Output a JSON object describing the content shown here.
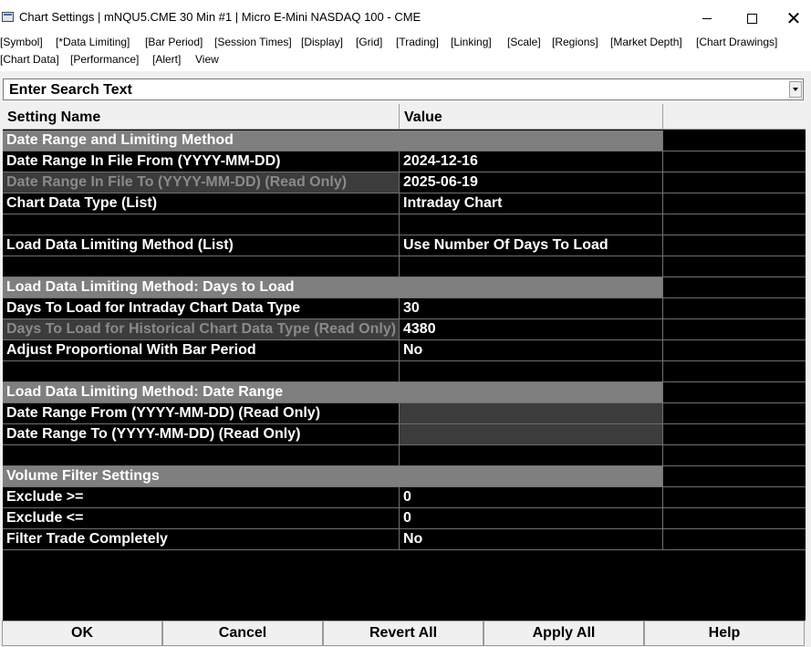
{
  "window": {
    "title": "Chart Settings | mNQU5.CME  30 Min  #1 | Micro E-Mini NASDAQ 100 - CME",
    "minimize_icon": "minimize-icon",
    "maximize_icon": "maximize-icon",
    "close_glyph": "✕"
  },
  "menu": {
    "items": [
      "[Symbol]",
      "[*Data Limiting]",
      "[Bar Period]",
      "[Session Times]",
      "[Display]",
      "[Grid]",
      "[Trading]",
      "[Linking]",
      "[Scale]",
      "[Regions]",
      "[Market Depth]",
      "[Chart Drawings]",
      "[Chart Data]",
      "[Performance]",
      "[Alert]",
      "View"
    ]
  },
  "search": {
    "text": "Enter Search Text"
  },
  "table": {
    "headers": {
      "name": "Setting Name",
      "value": "Value"
    },
    "rows": [
      {
        "type": "section",
        "name": "Date Range and Limiting Method",
        "value": ""
      },
      {
        "type": "normal",
        "name": "Date Range In File From (YYYY-MM-DD)",
        "value": "2024-12-16"
      },
      {
        "type": "readonly",
        "name": "Date Range In File To (YYYY-MM-DD) (Read Only)",
        "value": "2025-06-19"
      },
      {
        "type": "normal",
        "name": "Chart Data Type (List)",
        "value": "Intraday Chart"
      },
      {
        "type": "blank",
        "name": "",
        "value": ""
      },
      {
        "type": "normal",
        "name": "Load Data Limiting Method (List)",
        "value": "Use Number Of Days To Load"
      },
      {
        "type": "blank",
        "name": "",
        "value": ""
      },
      {
        "type": "section",
        "name": "Load Data Limiting Method: Days to Load",
        "value": ""
      },
      {
        "type": "normal",
        "name": "Days To Load for Intraday Chart Data Type",
        "value": "30"
      },
      {
        "type": "readonly",
        "name": "Days To Load for Historical Chart Data Type (Read Only)",
        "value": "4380"
      },
      {
        "type": "normal",
        "name": "Adjust Proportional With Bar Period",
        "value": "No"
      },
      {
        "type": "blank",
        "name": "",
        "value": ""
      },
      {
        "type": "section",
        "name": "Load Data Limiting Method: Date Range",
        "value": ""
      },
      {
        "type": "readonly-empty",
        "name": "Date Range From (YYYY-MM-DD) (Read Only)",
        "value": ""
      },
      {
        "type": "readonly-empty",
        "name": "Date Range To (YYYY-MM-DD) (Read Only)",
        "value": ""
      },
      {
        "type": "blank",
        "name": "",
        "value": ""
      },
      {
        "type": "section",
        "name": "Volume Filter Settings",
        "value": ""
      },
      {
        "type": "normal",
        "name": "Exclude >=",
        "value": "0"
      },
      {
        "type": "normal",
        "name": "Exclude <=",
        "value": "0"
      },
      {
        "type": "normal",
        "name": "Filter Trade Completely",
        "value": "No"
      }
    ]
  },
  "buttons": {
    "ok": "OK",
    "cancel": "Cancel",
    "revert_all": "Revert All",
    "apply_all": "Apply All",
    "help": "Help"
  },
  "colors": {
    "grid_background": "#000000",
    "section_background": "#7f7f7f",
    "readonly_background": "#3c3c3c",
    "readonly_text": "#8a8a8a"
  }
}
